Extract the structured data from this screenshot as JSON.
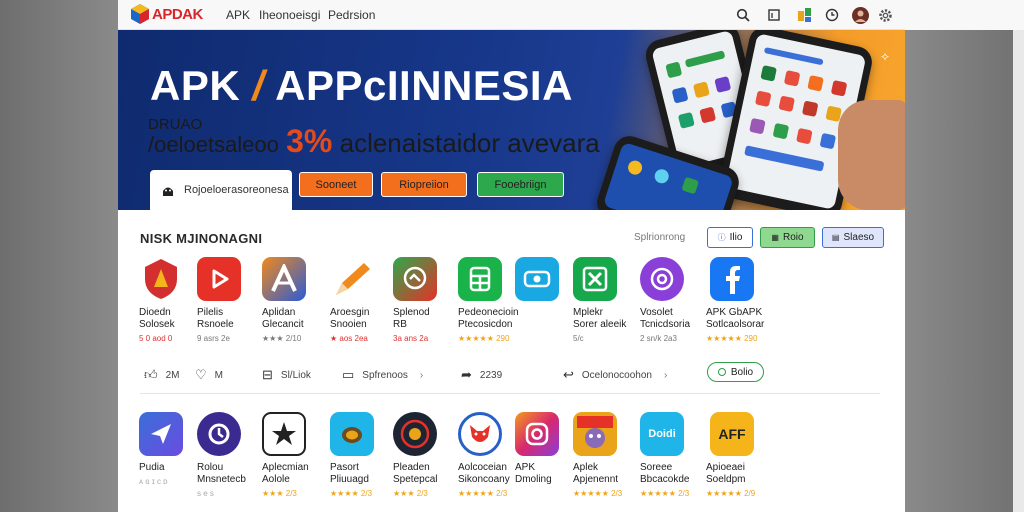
{
  "nav": {
    "brand": "APDAK",
    "links": [
      "APK",
      "Iheonoeisgi",
      "Pedrsion"
    ]
  },
  "hero": {
    "title_part1": "APK",
    "title_slash": "/",
    "title_part2": "APPᴄIINNESIA",
    "sub_small": "DRUAO",
    "sub_lead": "/oeloetsaleoo",
    "sub_pct": "3%",
    "sub_rest": "aclenaistaidor avevara",
    "search_text": "Rojoeloerasoreonesa",
    "buttons": [
      "Sooneet",
      "Riopreiion",
      "Fooebriign"
    ]
  },
  "section1": {
    "title": "NISK MJINONAGNI",
    "right_label": "Splrionrong",
    "pills": [
      "Ilio",
      "Roio",
      "Slaeso"
    ],
    "apps": [
      {
        "name1": "Dioedn",
        "name2": "Solosek",
        "rating": "5 0 aod 0",
        "icon": "shield-icon"
      },
      {
        "name1": "Pilelis",
        "name2": "Rsnoele",
        "rating": "9 asrs 2e",
        "icon": "play-icon"
      },
      {
        "name1": "Aplidan",
        "name2": "Glecancit",
        "rating": "★★★ 2/10",
        "icon": "a-icon"
      },
      {
        "name1": "Aroesgin",
        "name2": "Snooien",
        "rating": "★ aos 2ea",
        "icon": "pencil-icon"
      },
      {
        "name1": "Splenod",
        "name2": "RB",
        "rating": "3a ans 2a",
        "icon": "chat-icon"
      },
      {
        "name1": "Pedeonecioin",
        "name2": "Ptecosicdon",
        "rating": "★★★★★ 290",
        "icon": "grid-icon"
      },
      {
        "name1": "Mplekr",
        "name2": "Sorer aleeik",
        "rating": "5/c",
        "icon": "x-icon"
      },
      {
        "name1": "Vosolet",
        "name2": "Tcnicdsoria",
        "rating": "2 sn/k 2a3",
        "icon": "ring-icon"
      },
      {
        "name1": "APK GbAPK",
        "name2": "Sotlcaolsorar",
        "rating": "★★★★★ 290",
        "icon": "f-icon"
      }
    ],
    "actions": [
      "2M",
      "M",
      "Sl/Liok",
      "Spfrenoos",
      "2239",
      "Ocelonocoohon"
    ],
    "green_pill": "Bolio"
  },
  "section2": {
    "apps": [
      {
        "name1": "Pudia",
        "name2": "",
        "rating": "ᴀ ɢ ɪ ᴄ ᴅ",
        "icon": "send-icon"
      },
      {
        "name1": "Rolou",
        "name2": "Mnsnetecb",
        "rating": "s e s",
        "icon": "clock-icon"
      },
      {
        "name1": "Aplecmian",
        "name2": "Aolole",
        "rating": "★★★ 2/3",
        "icon": "star-icon"
      },
      {
        "name1": "Pasort",
        "name2": "Pliuuagd",
        "rating": "★★★★ 2/3",
        "icon": "turtle-icon"
      },
      {
        "name1": "Pleaden",
        "name2": "Spetepcal",
        "rating": "★★★ 2/3",
        "icon": "eye-icon"
      },
      {
        "name1": "Aolcoceian",
        "name2": "Sikoncoany",
        "rating": "★★★★★ 2/3",
        "icon": "fox-icon"
      },
      {
        "name1": "APK",
        "name2": "Dmoling",
        "rating": "",
        "icon": "insta-icon"
      },
      {
        "name1": "Aplek",
        "name2": "Apjenennt",
        "rating": "★★★★★ 2/3",
        "icon": "game-icon"
      },
      {
        "name1": "Soreee",
        "name2": "Bbcacokde",
        "rating": "★★★★★ 2/3",
        "icon": "bodit-icon"
      },
      {
        "name1": "Apioeaei",
        "name2": "Soeldpm",
        "rating": "★★★★★ 2/9",
        "icon": "aff-icon"
      }
    ],
    "bodit_label": "Doidi",
    "aff_label": "AFF"
  },
  "colors": {
    "hero_blue": "#17378a",
    "hero_orange": "#f49b28",
    "accent_orange": "#f08a1c",
    "green": "#2f9d4a",
    "brand_red": "#d9262b"
  }
}
